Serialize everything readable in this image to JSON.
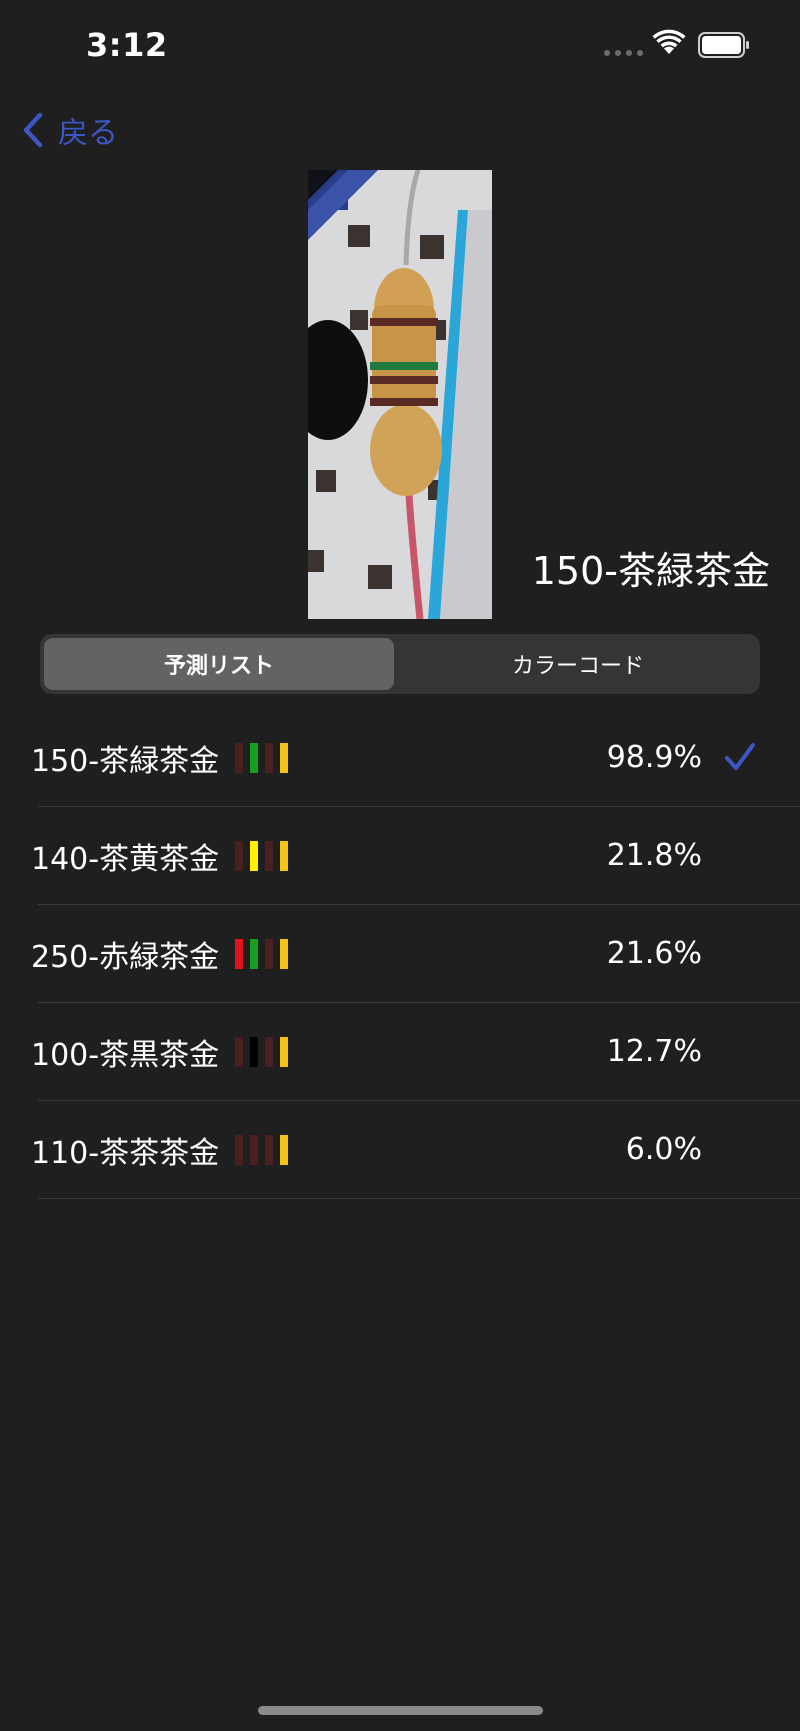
{
  "status_bar": {
    "time": "3:12"
  },
  "nav": {
    "back_label": "戻る"
  },
  "result": {
    "title": "150-茶緑茶金"
  },
  "segmented": {
    "tabs": [
      "予測リスト",
      "カラーコード"
    ],
    "selected": 0
  },
  "predictions": [
    {
      "label": "150-茶緑茶金",
      "percent": "98.9%",
      "selected": true,
      "bands": [
        "#4a1f1f",
        "#15a01e",
        "#4a1f1f",
        "#f2c418"
      ]
    },
    {
      "label": "140-茶黄茶金",
      "percent": "21.8%",
      "selected": false,
      "bands": [
        "#4a1f1f",
        "#fff200",
        "#4a1f1f",
        "#f2c418"
      ]
    },
    {
      "label": "250-赤緑茶金",
      "percent": "21.6%",
      "selected": false,
      "bands": [
        "#e0141a",
        "#15a01e",
        "#4a1f1f",
        "#f2c418"
      ]
    },
    {
      "label": "100-茶黒茶金",
      "percent": "12.7%",
      "selected": false,
      "bands": [
        "#4a1f1f",
        "#000000",
        "#4a1f1f",
        "#f2c418"
      ]
    },
    {
      "label": "110-茶茶茶金",
      "percent": "6.0%",
      "selected": false,
      "bands": [
        "#4a1f1f",
        "#4a1f1f",
        "#4a1f1f",
        "#f2c418"
      ]
    }
  ],
  "colors": {
    "accent": "#3d56c4",
    "background": "#1f1f1f",
    "separator": "#3a3a3a"
  },
  "icons": {
    "back": "chevron-left-icon",
    "check": "checkmark-icon",
    "wifi": "wifi-icon",
    "battery": "battery-icon"
  }
}
